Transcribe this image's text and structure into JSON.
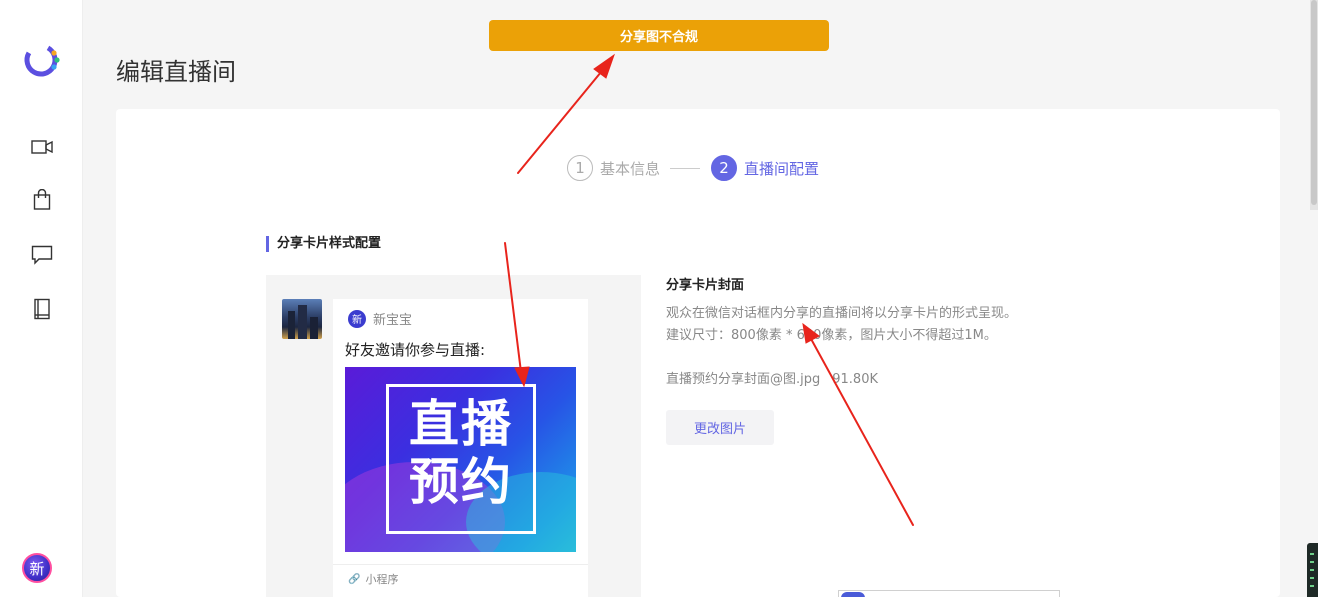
{
  "toast": {
    "text": "分享图不合规"
  },
  "page": {
    "title": "编辑直播间"
  },
  "sidebar": {
    "logo": "loading-ring-logo",
    "items": [
      {
        "name": "video-camera-icon"
      },
      {
        "name": "shopping-bag-icon"
      },
      {
        "name": "chat-bubble-icon"
      },
      {
        "name": "book-icon"
      }
    ],
    "avatar_text": "新"
  },
  "steps": [
    {
      "number": "1",
      "label": "基本信息",
      "state": "done"
    },
    {
      "number": "2",
      "label": "直播间配置",
      "state": "active"
    }
  ],
  "section": {
    "title": "分享卡片样式配置"
  },
  "preview": {
    "sender_badge": "新",
    "sender_name": "新宝宝",
    "message": "好友邀请你参与直播:",
    "cover_line1": "直播",
    "cover_line2": "预约",
    "footer": "小程序"
  },
  "share_cover": {
    "title": "分享卡片封面",
    "desc_line1": "观众在微信对话框内分享的直播间将以分享卡片的形式呈现。",
    "desc_line2": "建议尺寸：800像素 * 640像素，图片大小不得超过1M。",
    "file_name": "直播预约分享封面@图.jpg",
    "file_size": "91.80K",
    "change_button": "更改图片"
  },
  "colors": {
    "accent": "#6366e3",
    "toast_bg": "#eba107",
    "annotation_arrow": "#e8241c"
  }
}
